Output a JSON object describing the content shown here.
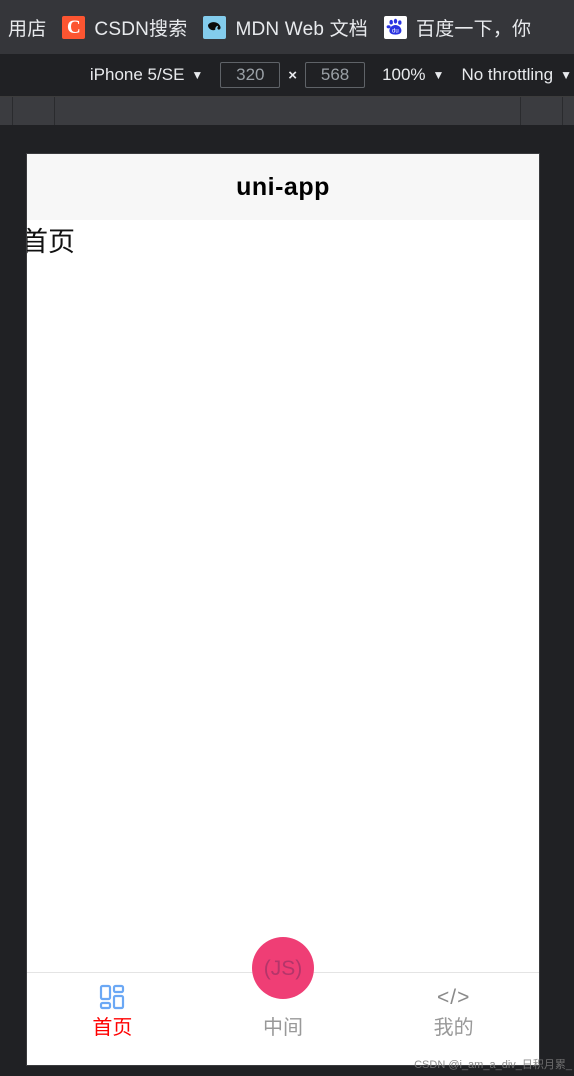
{
  "browser": {
    "bookmarks": [
      {
        "label": "用店",
        "icon": "",
        "truncated_left": true
      },
      {
        "label": "CSDN搜索",
        "icon": "csdn-icon"
      },
      {
        "label": "MDN Web 文档",
        "icon": "mdn-icon"
      },
      {
        "label": "百度一下，你",
        "icon": "baidu-icon"
      }
    ]
  },
  "device_toolbar": {
    "device_name": "iPhone 5/SE",
    "width": "320",
    "height": "568",
    "dimension_separator": "×",
    "zoom": "100%",
    "throttling": "No throttling",
    "caret": "▼"
  },
  "app": {
    "navbar_title": "uni-app",
    "page_heading": "首页",
    "tabbar": [
      {
        "label": "首页",
        "icon": "grid-icon",
        "active": true
      },
      {
        "label": "中间",
        "icon": "js-circle-icon",
        "active": false,
        "center_text": "(JS)"
      },
      {
        "label": "我的",
        "icon": "code-icon",
        "active": false
      }
    ]
  },
  "watermark": {
    "text": "CSDN @i_am_a_div_日积月累_"
  },
  "colors": {
    "accent_pink": "#ef3e75",
    "active_tab": "#ff0000",
    "inactive_tab": "#999999",
    "grid_icon_blue": "#6ba8f5",
    "csdn_red": "#fc5531",
    "mdn_blue": "#83ccec",
    "baidu_blue": "#2932e1"
  }
}
